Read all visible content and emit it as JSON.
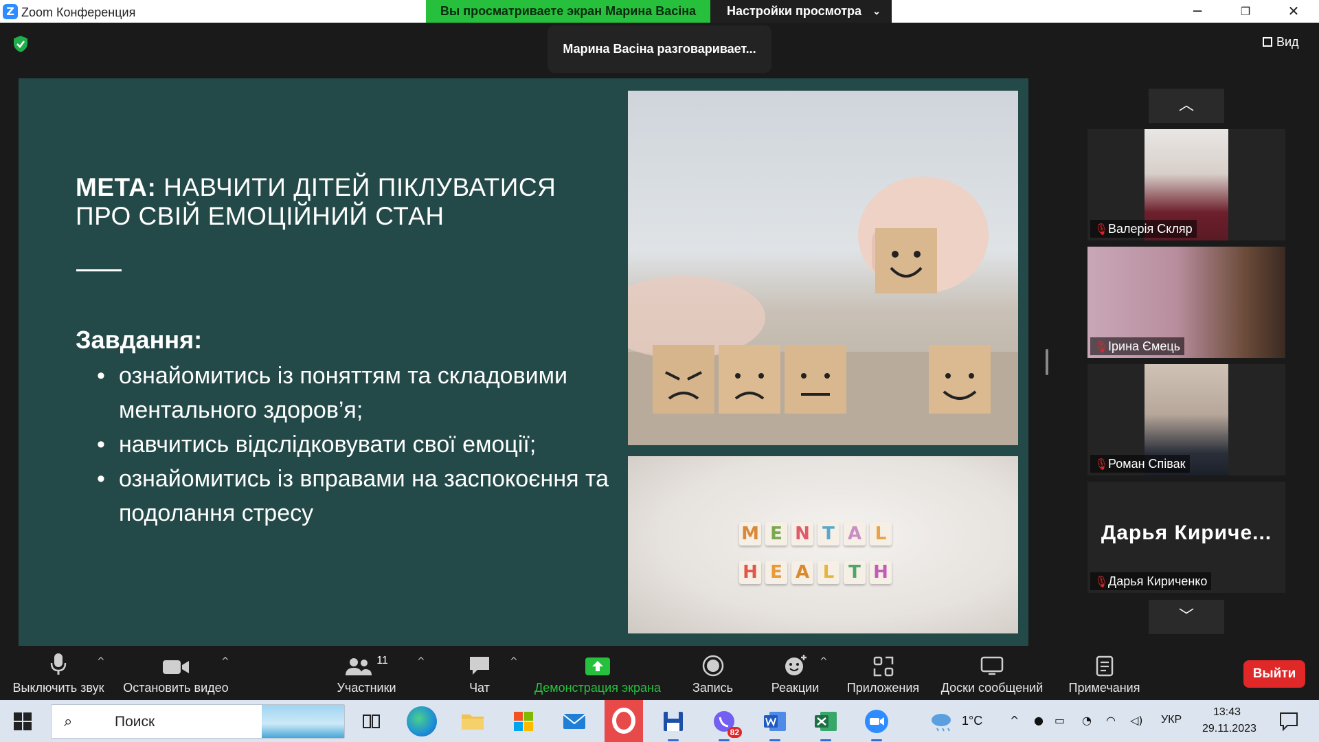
{
  "window": {
    "logo_letter": "Z",
    "title": "Zoom Конференция",
    "viewing_banner": "Вы просматриваете экран Марина Васіна",
    "view_settings": "Настройки просмотра"
  },
  "meeting": {
    "speaker_banner": "Марина Васіна разговаривает...",
    "view_button": "Вид"
  },
  "slide": {
    "title_bold": "МЕТА:",
    "title_rest": " НАВЧИТИ ДІТЕЙ ПІКЛУВАТИСЯ ПРО СВІЙ ЕМОЦІЙНИЙ СТАН",
    "tasks_heading": "Завдання:",
    "tasks": [
      "ознайомитись із поняттям та складовими ментального здоров’я;",
      "навчитись відслідковувати свої емоції;",
      "ознайомитись із вправами на заспокоєння та подолання стресу"
    ],
    "mental_tiles": [
      "M",
      "E",
      "N",
      "T",
      "A",
      "L"
    ],
    "health_tiles": [
      "H",
      "E",
      "A",
      "L",
      "T",
      "H"
    ]
  },
  "participants": [
    {
      "name": "Валерія Скляр",
      "muted": true
    },
    {
      "name": "Ірина Ємець",
      "muted": true
    },
    {
      "name": "Роман Співак",
      "muted": true
    },
    {
      "name": "Дарья Кириченко",
      "display_name": "Дарья  Кириче...",
      "muted": true
    }
  ],
  "toolbar": {
    "mute": "Выключить звук",
    "video": "Остановить видео",
    "participants": "Участники",
    "participants_count": "11",
    "chat": "Чат",
    "share": "Демонстрация экрана",
    "record": "Запись",
    "reactions": "Реакции",
    "apps": "Приложения",
    "whiteboards": "Доски сообщений",
    "notes": "Примечания",
    "leave": "Выйти"
  },
  "taskbar": {
    "search_placeholder": "Поиск",
    "viber_badge": "82",
    "temperature": "1°C",
    "language": "УКР",
    "time": "13:43",
    "date": "29.11.2023"
  },
  "colors": {
    "zoom_blue": "#2d8cff",
    "share_green": "#27c03d",
    "slide_bg": "#234a48",
    "leave_red": "#e02828"
  }
}
